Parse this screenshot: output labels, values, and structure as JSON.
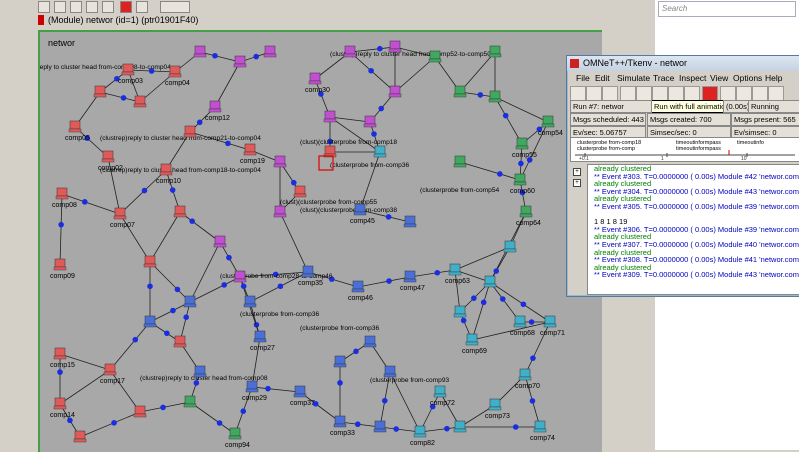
{
  "module_window": {
    "title": "(Module) networ  (id=1)  (ptr01901F40)",
    "canvas_label": "networ"
  },
  "search": {
    "placeholder": "Search"
  },
  "tkenv": {
    "title": "OMNeT++/Tkenv - networ",
    "menu": [
      "File",
      "Edit",
      "Simulate",
      "Trace",
      "Inspect",
      "View",
      "Options",
      "Help"
    ],
    "tooltip": "Run with full animation (F5)",
    "run_label": "Run #7: networ",
    "time_label": "(0.00s)",
    "running_label": "Running",
    "msgs_scheduled": "Msgs scheduled: 443",
    "msgs_created": "Msgs created: 700",
    "msgs_present": "Msgs present: 565",
    "ev_sec": "Ev/sec: 5.06757",
    "simsec_sec": "Simsec/sec: 0",
    "ev_simsec": "Ev/simsec: 0",
    "timeline_msgs": [
      "clusterprobe from-comp18",
      "clusterprobe from-comp",
      "timeoutinformpass",
      "timeoutinformpass",
      "timeoutinfo"
    ],
    "timeline_ticks": [
      "+0.1",
      "1",
      "10"
    ],
    "log": [
      {
        "c": "g",
        "t": "already clustered"
      },
      {
        "c": "b",
        "t": "** Event #303.  T=0.0000000  ( 0.00s)  Module #42 'networ.comp41'"
      },
      {
        "c": "g",
        "t": "already clustered"
      },
      {
        "c": "b",
        "t": "** Event #304.  T=0.0000000  ( 0.00s)  Module #43 'networ.comp42'"
      },
      {
        "c": "g",
        "t": "already clustered"
      },
      {
        "c": "b",
        "t": "** Event #305.  T=0.0000000  ( 0.00s)  Module #39 'networ.comp38'"
      },
      {
        "c": "k",
        "t": ""
      },
      {
        "c": "k",
        "t": "     1  8  1  8     19"
      },
      {
        "c": "b",
        "t": "** Event #306.  T=0.0000000  ( 0.00s)  Module #39 'networ.comp38'"
      },
      {
        "c": "g",
        "t": "already clustered"
      },
      {
        "c": "b",
        "t": "** Event #307.  T=0.0000000  ( 0.00s)  Module #40 'networ.comp39'"
      },
      {
        "c": "g",
        "t": "already clustered"
      },
      {
        "c": "b",
        "t": "** Event #308.  T=0.0000000  ( 0.00s)  Module #41 'networ.comp40'"
      },
      {
        "c": "g",
        "t": "already clustered"
      },
      {
        "c": "b",
        "t": "** Event #309.  T=0.0000000  ( 0.00s)  Module #43 'networ.comp42'"
      }
    ]
  },
  "network": {
    "nodes": [
      {
        "n": "comp03",
        "c": "#e05a5a"
      },
      {
        "n": "comp04",
        "c": "#e05a5a"
      },
      {
        "n": "comp12",
        "c": "#c050d0"
      },
      {
        "n": "comp30",
        "c": "#c050d0"
      },
      {
        "n": "comp05",
        "c": "#e05a5a"
      },
      {
        "n": "comp02",
        "c": "#e05a5a"
      },
      {
        "n": "comp10",
        "c": "#e05a5a"
      },
      {
        "n": "comp19",
        "c": "#e05a5a"
      },
      {
        "n": "comp08",
        "c": "#e05a5a"
      },
      {
        "n": "comp07",
        "c": "#e05a5a"
      },
      {
        "n": "comp54",
        "c": "#40a860"
      },
      {
        "n": "comp55",
        "c": "#40a860"
      },
      {
        "n": "comp60",
        "c": "#40a860"
      },
      {
        "n": "comp45",
        "c": "#4a70d8"
      },
      {
        "n": "comp35",
        "c": "#4a70d8"
      },
      {
        "n": "comp46",
        "c": "#4a70d8"
      },
      {
        "n": "comp47",
        "c": "#4a70d8"
      },
      {
        "n": "comp63",
        "c": "#40b0c8"
      },
      {
        "n": "comp64",
        "c": "#40a860"
      },
      {
        "n": "comp09",
        "c": "#e05a5a"
      },
      {
        "n": "comp68",
        "c": "#40b0c8"
      },
      {
        "n": "comp71",
        "c": "#40b0c8"
      },
      {
        "n": "comp69",
        "c": "#40b0c8"
      },
      {
        "n": "comp27",
        "c": "#4a70d8"
      },
      {
        "n": "comp15",
        "c": "#e05a5a"
      },
      {
        "n": "comp17",
        "c": "#e05a5a"
      },
      {
        "n": "comp29",
        "c": "#4a70d8"
      },
      {
        "n": "comp70",
        "c": "#40b0c8"
      },
      {
        "n": "comp14",
        "c": "#e05a5a"
      },
      {
        "n": "comp37",
        "c": "#4a70d8"
      },
      {
        "n": "comp72",
        "c": "#40b0c8"
      },
      {
        "n": "comp73",
        "c": "#40b0c8"
      },
      {
        "n": "comp94",
        "c": "#40a860"
      },
      {
        "n": "comp74",
        "c": "#40b0c8"
      },
      {
        "n": "comp82",
        "c": "#40b0c8"
      },
      {
        "n": "comp33",
        "c": "#4a70d8"
      }
    ],
    "labels": [
      "(clustrep)reply to cluster head from-comp08-to-comp04",
      "(clustrep)reply to cluster head from-comp52-to-comp50",
      "(clustrep)reply to cluster head from-comp21-to-comp04",
      "(clustrep)reply to cluster head from-comp18-to-comp04",
      "(clust)(clusterprobe from-comp18",
      "(clusterprobe from-comp36",
      "(clusterprobe from-comp54",
      "(clust)(clusterprobe from-comp55",
      "(clusterprobe from-comp28-to-comp46",
      "(clust)(clusterprobe from-comp38",
      "(clusterprobe from-comp36",
      "(clustrep)reply to cluster head from-comp08",
      "(clusterprobe from-comp93",
      "(clusterprobe from-comp36"
    ]
  }
}
